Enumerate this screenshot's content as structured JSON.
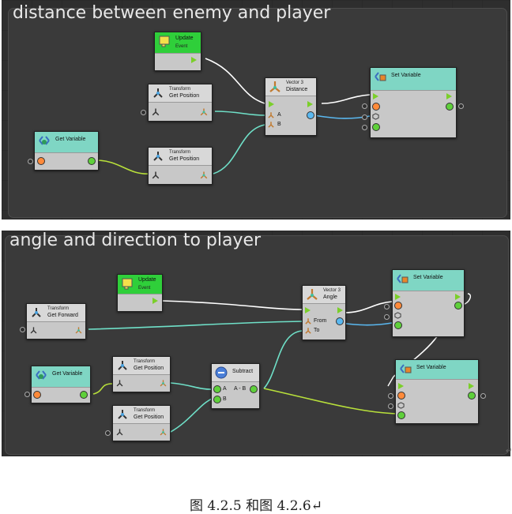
{
  "graphs": [
    {
      "title": "distance between enemy and player",
      "nodes": {
        "update": {
          "title": "Update",
          "sub": "Event"
        },
        "tf1": {
          "cat": "Transform",
          "title": "Get Position"
        },
        "tf2": {
          "cat": "Transform",
          "title": "Get Position"
        },
        "getvar": {
          "title": "Get Variable"
        },
        "v3": {
          "cat": "Vector 3",
          "title": "Distance",
          "port_a": "A",
          "port_b": "B"
        },
        "setvar": {
          "title": "Set Variable"
        }
      }
    },
    {
      "title": "angle and direction to player",
      "nodes": {
        "update": {
          "title": "Update",
          "sub": "Event"
        },
        "fwd": {
          "cat": "Transform",
          "title": "Get Forward"
        },
        "getvar": {
          "title": "Get Variable"
        },
        "tf1": {
          "cat": "Transform",
          "title": "Get Position"
        },
        "tf2": {
          "cat": "Transform",
          "title": "Get Position"
        },
        "sub": {
          "title": "Subtract",
          "port_a": "A",
          "port_b": "B",
          "out": "A - B"
        },
        "v3": {
          "cat": "Vector 3",
          "title": "Angle",
          "port_from": "From",
          "port_to": "To"
        },
        "set1": {
          "title": "Set Variable"
        },
        "set2": {
          "title": "Set Variable"
        }
      }
    }
  ],
  "caption": "图 4.2.5 和图 4.2.6↵",
  "colors": {
    "canvas": "#2e2e2e",
    "flow": "#7bcf2a",
    "data_teal": "#6fe0c8",
    "data_blue": "#5ab8f0",
    "data_lime": "#b8e03a"
  }
}
